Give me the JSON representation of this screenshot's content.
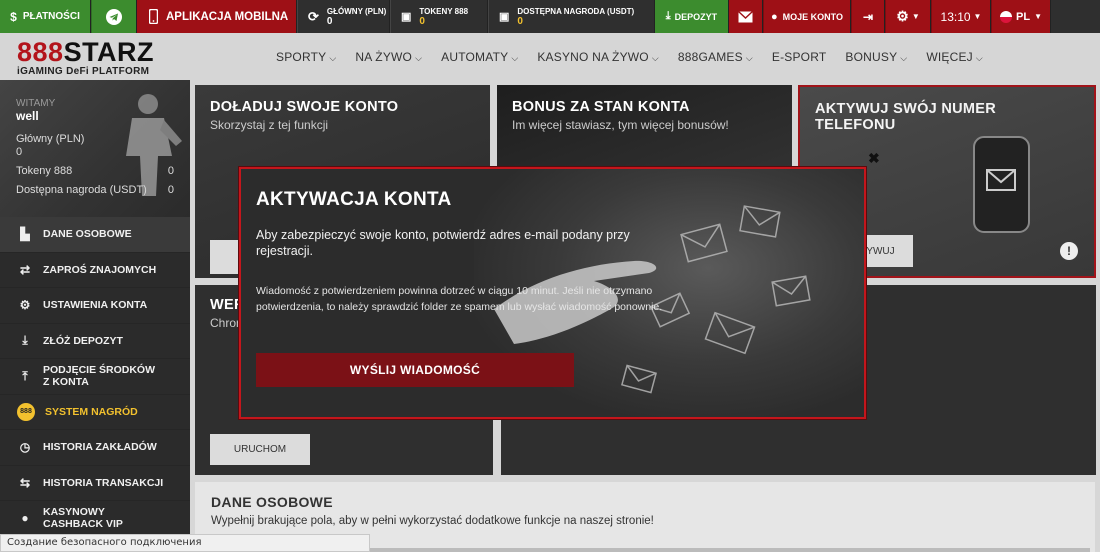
{
  "topbar": {
    "payments": "PŁATNOŚCI",
    "mobile_app": "APLIKACJA MOBILNA",
    "balance_main_label": "GŁÓWNY (PLN)",
    "balance_main_value": "0",
    "tokens_label": "TOKENY 888",
    "tokens_value": "0",
    "reward_label": "DOSTĘPNA NAGRODA (USDT)",
    "reward_value": "0",
    "deposit": "DEPOZYT",
    "my_account": "MOJE KONTO",
    "time": "13:10",
    "language": "PL"
  },
  "logo": {
    "brand_prefix": "888",
    "brand_suffix": "STARZ",
    "tagline": "iGAMING DeFi PLATFORM"
  },
  "nav": {
    "items": [
      {
        "label": "SPORTY",
        "caret": true
      },
      {
        "label": "NA ŻYWO",
        "caret": true
      },
      {
        "label": "AUTOMATY",
        "caret": true
      },
      {
        "label": "KASYNO NA ŻYWO",
        "caret": true
      },
      {
        "label": "888GAMES",
        "caret": true
      },
      {
        "label": "E-SPORT",
        "caret": false
      },
      {
        "label": "BONUSY",
        "caret": true
      },
      {
        "label": "WIĘCEJ",
        "caret": true
      }
    ]
  },
  "profile": {
    "welcome": "WITAMY",
    "username": "well",
    "main_label": "Główny (PLN)",
    "main_value": "0",
    "tokens_label": "Tokeny 888",
    "tokens_value": "0",
    "reward_label": "Dostępna nagroda (USDT)",
    "reward_value": "0"
  },
  "sidebar": {
    "items": [
      {
        "label": "DANE OSOBOWE",
        "icon": "user-icon",
        "active": true
      },
      {
        "label": "ZAPROŚ ZNAJOMYCH",
        "icon": "handshake-icon"
      },
      {
        "label": "USTAWIENIA KONTA",
        "icon": "gears-icon"
      },
      {
        "label": "ZŁÓŻ DEPOZYT",
        "icon": "download-icon"
      },
      {
        "label": "PODJĘCIE ŚRODKÓW Z KONTA",
        "icon": "upload-icon"
      },
      {
        "label": "SYSTEM NAGRÓD",
        "icon": "coin-icon",
        "highlight": true
      },
      {
        "label": "HISTORIA ZAKŁADÓW",
        "icon": "clock-icon"
      },
      {
        "label": "HISTORIA TRANSAKCJI",
        "icon": "arrows-icon"
      },
      {
        "label": "KASYNOWY CASHBACK VIP",
        "icon": "dot-icon"
      }
    ]
  },
  "cards": {
    "topup": {
      "title": "DOŁADUJ SWOJE KONTO",
      "subtitle": "Skorzystaj z tej funkcji"
    },
    "bonus": {
      "title": "BONUS ZA STAN KONTA",
      "subtitle": "Im więcej stawiasz, tym więcej bonusów!"
    },
    "phone": {
      "title": "AKTYWUJ SWÓJ NUMER TELEFONU",
      "button": "YWUJ"
    },
    "verify": {
      "title": "WER",
      "subtitle": "Chron",
      "button": "URUCHOM"
    },
    "personal": {
      "title": "DANE OSOBOWE",
      "subtitle": "Wypełnij brakujące pola, aby w pełni wykorzystać dodatkowe funkcje na naszej stronie!"
    }
  },
  "modal": {
    "title": "AKTYWACJA KONTA",
    "lead": "Aby zabezpieczyć swoje konto, potwierdź adres e-mail podany przy rejestracji.",
    "info": "Wiadomość z potwierdzeniem powinna dotrzeć w ciągu 10 minut. Jeśli nie otrzymano potwierdzenia, to należy sprawdzić folder ze spamem lub wysłać wiadomość ponownie.",
    "send_button": "WYŚLIJ WIADOMOŚĆ",
    "close": "✖"
  },
  "statusbar": {
    "text": "Создание безопасного подключения"
  },
  "colors": {
    "green": "#3c8c2e",
    "red": "#9e1016",
    "gold": "#f2c12e",
    "modal_border": "#c4161c"
  }
}
